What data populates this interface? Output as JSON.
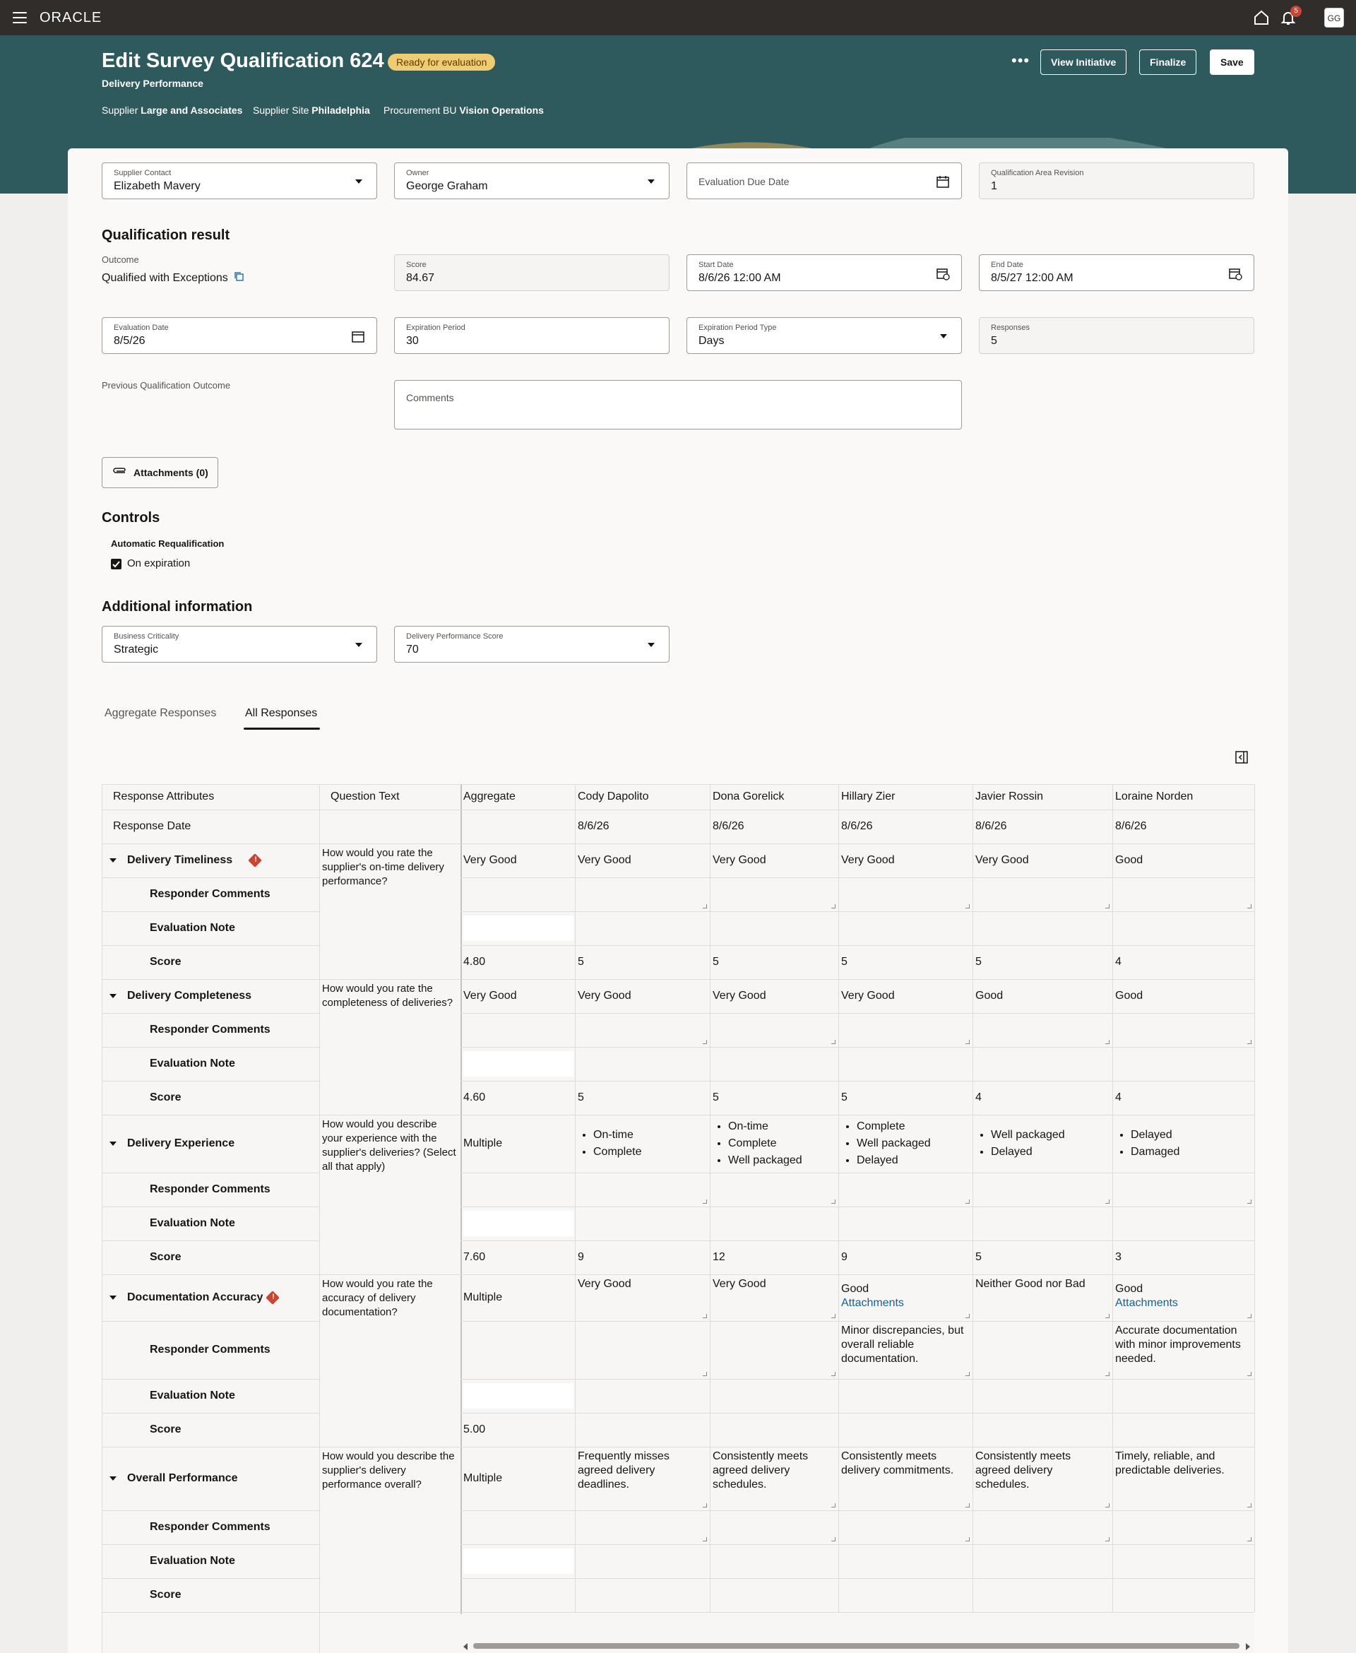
{
  "app": {
    "logo": "ORACLE",
    "notification_count": "5",
    "avatar_initials": "GG"
  },
  "header": {
    "title": "Edit Survey Qualification 624",
    "status": "Ready for evaluation",
    "subtitle": "Delivery Performance",
    "supplier_label": "Supplier",
    "supplier_value": "Large and Associates",
    "site_label": "Supplier Site",
    "site_value": "Philadelphia",
    "bu_label": "Procurement BU",
    "bu_value": "Vision Operations",
    "more_label": "•••",
    "view_initiative": "View Initiative",
    "finalize": "Finalize",
    "save": "Save"
  },
  "fields": {
    "supplier_contact": {
      "label": "Supplier Contact",
      "value": "Elizabeth Mavery"
    },
    "owner": {
      "label": "Owner",
      "value": "George Graham"
    },
    "evaluation_due_date": {
      "label": "Evaluation Due Date"
    },
    "qa_revision": {
      "label": "Qualification Area Revision",
      "value": "1"
    }
  },
  "qualification_result": {
    "title": "Qualification result",
    "outcome_label": "Outcome",
    "outcome_value": "Qualified with Exceptions",
    "score": {
      "label": "Score",
      "value": "84.67"
    },
    "start_date": {
      "label": "Start Date",
      "value": "8/6/26 12:00 AM"
    },
    "end_date": {
      "label": "End Date",
      "value": "8/5/27 12:00 AM"
    },
    "evaluation_date": {
      "label": "Evaluation Date",
      "value": "8/5/26"
    },
    "expiration_period": {
      "label": "Expiration Period",
      "value": "30"
    },
    "expiration_period_type": {
      "label": "Expiration Period Type",
      "value": "Days"
    },
    "responses": {
      "label": "Responses",
      "value": "5"
    },
    "previous_outcome_label": "Previous Qualification Outcome",
    "comments_label": "Comments",
    "attachments": "Attachments (0)"
  },
  "controls": {
    "title": "Controls",
    "auto_requal_label": "Automatic Requalification",
    "on_expiration": "On expiration",
    "on_expiration_checked": true
  },
  "additional": {
    "title": "Additional information",
    "business_criticality": {
      "label": "Business Criticality",
      "value": "Strategic"
    },
    "delivery_performance_score": {
      "label": "Delivery Performance Score",
      "value": "70"
    }
  },
  "tabs": [
    {
      "label": "Aggregate Responses",
      "active": false
    },
    {
      "label": "All Responses",
      "active": true
    }
  ],
  "table": {
    "headers": [
      "Response Attributes",
      "Question Text",
      "Aggregate",
      "Cody Dapolito",
      "Dona Gorelick",
      "Hillary Zier",
      "Javier Rossin",
      "Loraine Norden"
    ],
    "response_date_label": "Response Date",
    "response_dates": [
      "8/6/26",
      "8/6/26",
      "8/6/26",
      "8/6/26",
      "8/6/26"
    ],
    "sub_labels": {
      "comments": "Responder Comments",
      "note": "Evaluation Note",
      "score": "Score"
    },
    "attachments_link": "Attachments",
    "sections": [
      {
        "name": "Delivery Timeliness",
        "warning": true,
        "question": "How would you rate the supplier's on-time delivery performance?",
        "aggregate": "Very Good",
        "answers": [
          "Very Good",
          "Very Good",
          "Very Good",
          "Very Good",
          "Good"
        ],
        "comments": [
          "",
          "",
          "",
          "",
          ""
        ],
        "agg_score": "4.80",
        "scores": [
          "5",
          "5",
          "5",
          "5",
          "4"
        ]
      },
      {
        "name": "Delivery Completeness",
        "warning": false,
        "question": "How would you rate the completeness of deliveries?",
        "aggregate": "Very Good",
        "answers": [
          "Very Good",
          "Very Good",
          "Very Good",
          "Good",
          "Good"
        ],
        "comments": [
          "",
          "",
          "",
          "",
          ""
        ],
        "agg_score": "4.60",
        "scores": [
          "5",
          "5",
          "5",
          "4",
          "4"
        ]
      },
      {
        "name": "Delivery Experience",
        "warning": false,
        "question": "How would you describe your experience with the supplier's deliveries? (Select all that apply)",
        "aggregate": "Multiple",
        "multi_answers": [
          [
            "On-time",
            "Complete"
          ],
          [
            "On-time",
            "Complete",
            "Well packaged"
          ],
          [
            "Complete",
            "Well packaged",
            "Delayed"
          ],
          [
            "Well packaged",
            "Delayed"
          ],
          [
            "Delayed",
            "Damaged"
          ]
        ],
        "comments": [
          "",
          "",
          "",
          "",
          ""
        ],
        "agg_score": "7.60",
        "scores": [
          "9",
          "12",
          "9",
          "5",
          "3"
        ]
      },
      {
        "name": "Documentation Accuracy",
        "warning": true,
        "question": "How would you rate the accuracy of delivery documentation?",
        "aggregate": "Multiple",
        "answers": [
          "Very Good",
          "Very Good",
          "Good",
          "Neither Good nor Bad",
          "Good"
        ],
        "attachments": [
          false,
          false,
          true,
          false,
          true
        ],
        "comments": [
          "",
          "",
          "Minor discrepancies, but overall reliable documentation.",
          "",
          "Accurate documentation with minor improvements needed."
        ],
        "agg_score": "5.00",
        "scores": [
          "",
          "",
          "",
          "",
          ""
        ]
      },
      {
        "name": "Overall Performance",
        "warning": false,
        "question": "How would you describe the supplier's delivery performance overall?",
        "aggregate": "Multiple",
        "answers": [
          "Frequently misses agreed delivery deadlines.",
          "Consistently meets agreed delivery schedules.",
          "Consistently meets delivery commitments.",
          "Consistently meets agreed delivery schedules.",
          "Timely, reliable, and predictable deliveries."
        ],
        "comments": [
          "",
          "",
          "",
          "",
          ""
        ],
        "agg_score": "",
        "scores": [
          "",
          "",
          "",
          "",
          ""
        ]
      }
    ]
  },
  "colors": {
    "topbar": "#312d2a",
    "banner": "#2f5a5d",
    "badge": "#f0cc71",
    "warning": "#c74634",
    "link": "#136295"
  }
}
